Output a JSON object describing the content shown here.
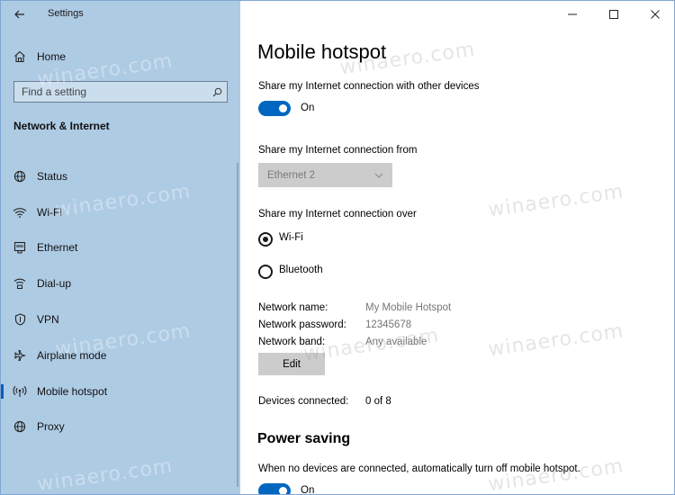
{
  "window": {
    "app_title": "Settings"
  },
  "sidebar": {
    "home_label": "Home",
    "search_placeholder": "Find a setting",
    "section_heading": "Network & Internet",
    "items": [
      {
        "label": "Status",
        "icon": "globe-icon"
      },
      {
        "label": "Wi-Fi",
        "icon": "wifi-icon"
      },
      {
        "label": "Ethernet",
        "icon": "ethernet-icon"
      },
      {
        "label": "Dial-up",
        "icon": "dialup-icon"
      },
      {
        "label": "VPN",
        "icon": "vpn-shield-icon"
      },
      {
        "label": "Airplane mode",
        "icon": "airplane-icon"
      },
      {
        "label": "Mobile hotspot",
        "icon": "hotspot-icon",
        "selected": true
      },
      {
        "label": "Proxy",
        "icon": "globe-icon"
      }
    ]
  },
  "main": {
    "title": "Mobile hotspot",
    "share_desc": "Share my Internet connection with other devices",
    "share_toggle": {
      "state": "On",
      "on": true
    },
    "share_from_desc": "Share my Internet connection from",
    "share_from_value": "Ethernet 2",
    "share_over_desc": "Share my Internet connection over",
    "share_over_options": [
      {
        "label": "Wi-Fi",
        "checked": true
      },
      {
        "label": "Bluetooth",
        "checked": false
      }
    ],
    "network": {
      "name_label": "Network name:",
      "name_value": "My Mobile Hotspot",
      "password_label": "Network password:",
      "password_value": "12345678",
      "band_label": "Network band:",
      "band_value": "Any available"
    },
    "edit_label": "Edit",
    "devices_label": "Devices connected:",
    "devices_value": "0 of 8",
    "power_saving_title": "Power saving",
    "power_saving_desc": "When no devices are connected, automatically turn off mobile hotspot.",
    "power_saving_toggle": {
      "state": "On",
      "on": true
    }
  },
  "watermark": "winaero.com",
  "colors": {
    "sidebar_bg": "#aecbe4",
    "accent": "#0067c0"
  }
}
